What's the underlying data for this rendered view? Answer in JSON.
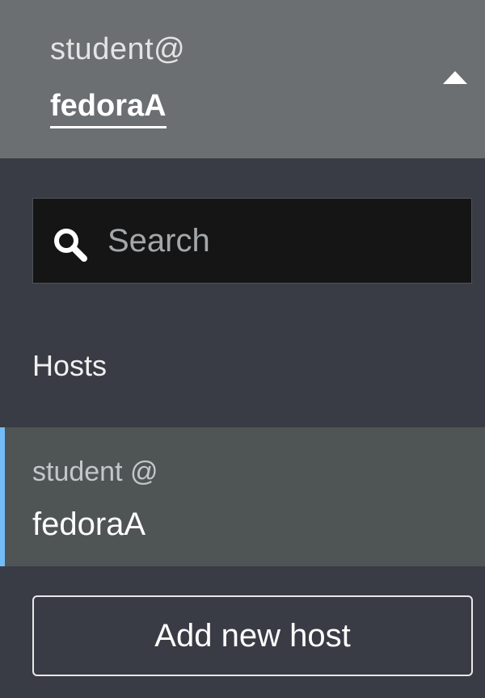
{
  "header": {
    "user": "student@",
    "hostname": "fedoraA",
    "toggle_icon": "caret-up-icon"
  },
  "search": {
    "placeholder": "Search",
    "value": "",
    "icon": "search-icon"
  },
  "hosts_section": {
    "label": "Hosts",
    "items": [
      {
        "user": "student @",
        "hostname": "fedoraA",
        "active": true
      }
    ]
  },
  "add_host_button": {
    "label": "Add new host"
  },
  "colors": {
    "header_bg": "#6b6f71",
    "panel_bg": "#393c44",
    "active_item_bg": "#4f5455",
    "active_accent": "#73bcf7",
    "search_bg": "#151515"
  }
}
